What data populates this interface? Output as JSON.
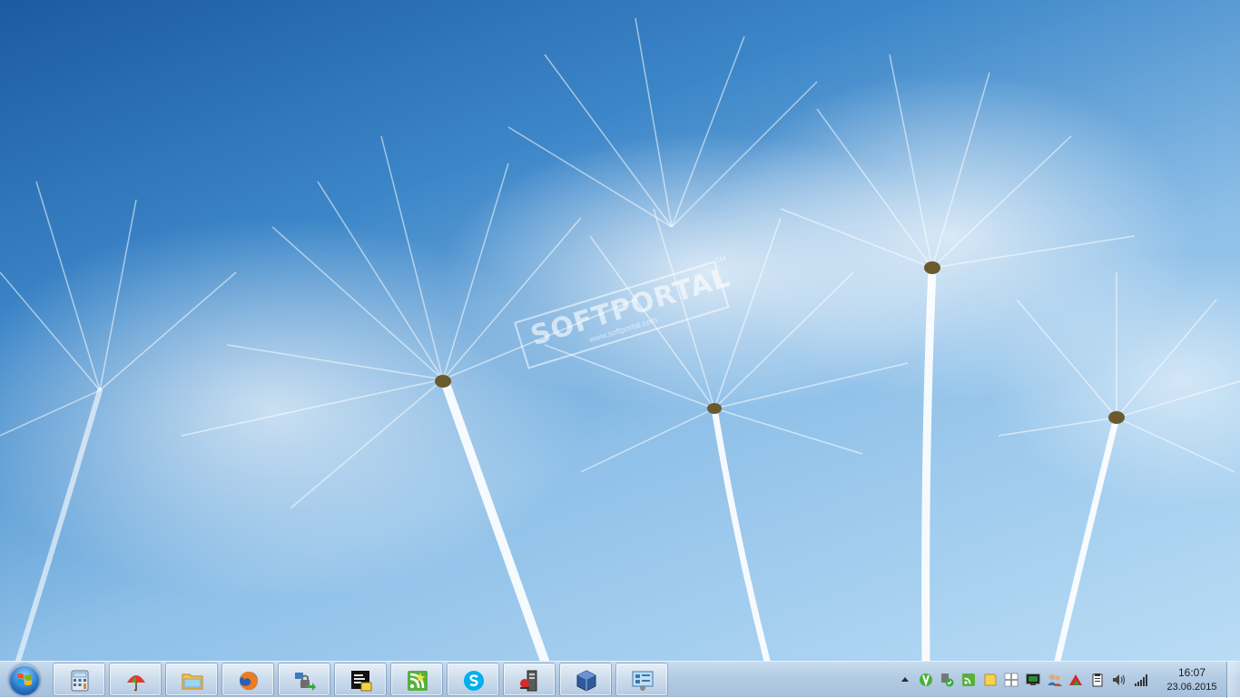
{
  "desktop": {
    "wallpaper": "dandelion-seeds",
    "watermark": {
      "name": "SOFTPORTAL",
      "url": "www.softportal.com",
      "tm": "TM"
    }
  },
  "taskbar": {
    "start_label": "Start",
    "pinned": [
      {
        "id": "calculator",
        "icon": "calculator-icon"
      },
      {
        "id": "umbrella-app",
        "icon": "umbrella-icon"
      },
      {
        "id": "explorer",
        "icon": "folder-icon"
      },
      {
        "id": "firefox",
        "icon": "firefox-icon"
      },
      {
        "id": "network-lock",
        "icon": "lock-transfer-icon"
      },
      {
        "id": "console",
        "icon": "console-icon"
      },
      {
        "id": "rss-reader",
        "icon": "rss-icon"
      },
      {
        "id": "skype",
        "icon": "skype-icon"
      },
      {
        "id": "server-tool",
        "icon": "server-icon"
      },
      {
        "id": "virtualbox",
        "icon": "cube-icon"
      },
      {
        "id": "control-panel",
        "icon": "control-panel-icon"
      }
    ],
    "tray": {
      "icons": [
        "show-hidden-icon",
        "torrent-icon",
        "security-icon",
        "rss-tray-icon",
        "notes-icon",
        "windows-update-icon",
        "monitor-icon",
        "users-icon",
        "antivirus-icon",
        "clipboard-icon",
        "volume-icon",
        "network-signal-icon"
      ],
      "time": "16:07",
      "date": "23.06.2015"
    }
  }
}
